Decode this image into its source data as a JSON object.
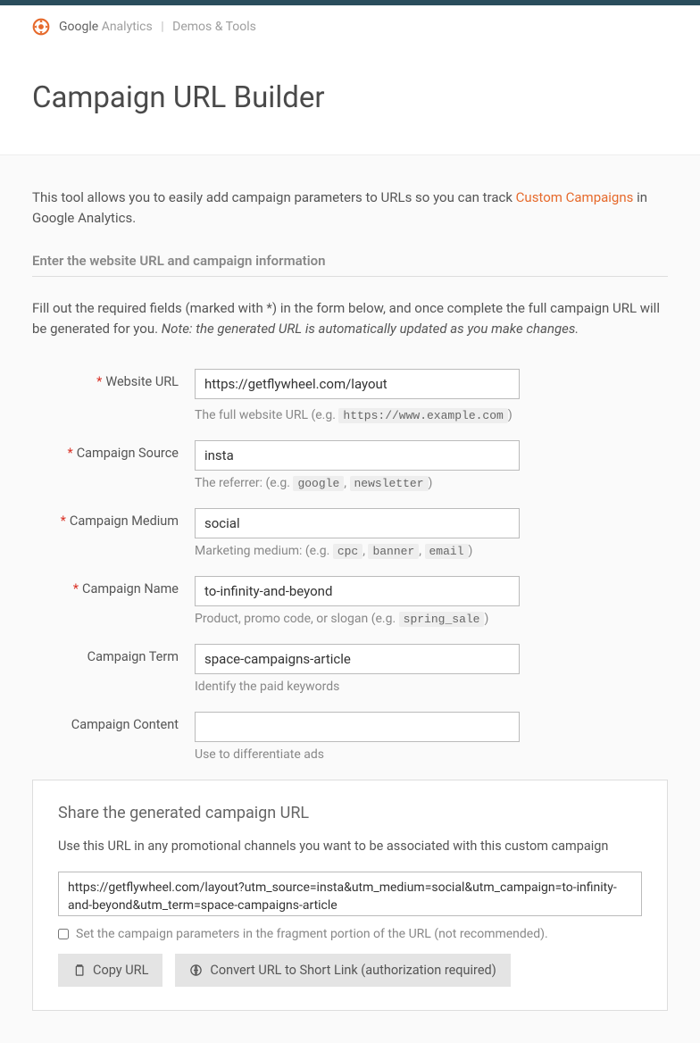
{
  "header": {
    "brand_main": "Google",
    "brand_sub": "Analytics",
    "brand_section": "Demos & Tools"
  },
  "title": "Campaign URL Builder",
  "intro": {
    "pre": "This tool allows you to easily add campaign parameters to URLs so you can track ",
    "link": "Custom Campaigns",
    "post": " in Google Analytics."
  },
  "section_label": "Enter the website URL and campaign information",
  "instructions": {
    "text": "Fill out the required fields (marked with *) in the form below, and once complete the full campaign URL will be generated for you. ",
    "note": "Note: the generated URL is automatically updated as you make changes."
  },
  "fields": {
    "url": {
      "label": "Website URL",
      "required": true,
      "value": "https://getflywheel.com/layout",
      "help_pre": "The full website URL (e.g. ",
      "help_code": "https://www.example.com",
      "help_post": ")"
    },
    "source": {
      "label": "Campaign Source",
      "required": true,
      "value": "insta",
      "help_pre": "The referrer: (e.g. ",
      "help_code1": "google",
      "help_sep": ", ",
      "help_code2": "newsletter",
      "help_post": ")"
    },
    "medium": {
      "label": "Campaign Medium",
      "required": true,
      "value": "social",
      "help_pre": "Marketing medium: (e.g. ",
      "help_code1": "cpc",
      "help_code2": "banner",
      "help_code3": "email",
      "help_post": ")"
    },
    "name": {
      "label": "Campaign Name",
      "required": true,
      "value": "to-infinity-and-beyond",
      "help_pre": "Product, promo code, or slogan (e.g. ",
      "help_code": "spring_sale",
      "help_post": ")"
    },
    "term": {
      "label": "Campaign Term",
      "required": false,
      "value": "space-campaigns-article",
      "help": "Identify the paid keywords"
    },
    "content": {
      "label": "Campaign Content",
      "required": false,
      "value": "",
      "help": "Use to differentiate ads"
    }
  },
  "share": {
    "title": "Share the generated campaign URL",
    "desc": "Use this URL in any promotional channels you want to be associated with this custom campaign",
    "generated_url": "https://getflywheel.com/layout?utm_source=insta&utm_medium=social&utm_campaign=to-infinity-and-beyond&utm_term=space-campaigns-article",
    "fragment_label": "Set the campaign parameters in the fragment portion of the URL (not recommended).",
    "copy_btn": "Copy URL",
    "short_btn": "Convert URL to Short Link (authorization required)"
  }
}
